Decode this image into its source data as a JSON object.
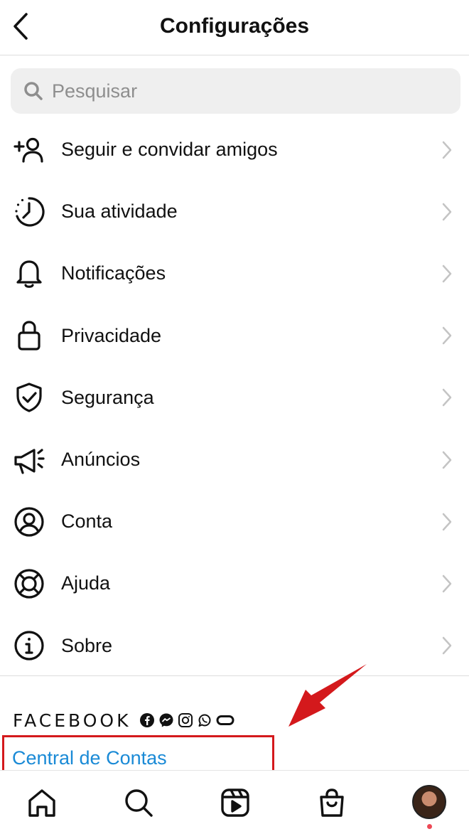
{
  "header": {
    "title": "Configurações"
  },
  "search": {
    "placeholder": "Pesquisar"
  },
  "menu": [
    {
      "label": "Seguir e convidar amigos",
      "icon": "add-person-icon"
    },
    {
      "label": "Sua atividade",
      "icon": "activity-clock-icon"
    },
    {
      "label": "Notificações",
      "icon": "bell-icon"
    },
    {
      "label": "Privacidade",
      "icon": "lock-icon"
    },
    {
      "label": "Segurança",
      "icon": "shield-check-icon"
    },
    {
      "label": "Anúncios",
      "icon": "megaphone-icon"
    },
    {
      "label": "Conta",
      "icon": "account-circle-icon"
    },
    {
      "label": "Ajuda",
      "icon": "lifebuoy-icon"
    },
    {
      "label": "Sobre",
      "icon": "info-icon"
    }
  ],
  "meta_section": {
    "brand": "FACEBOOK",
    "brand_icons": [
      "facebook-icon",
      "messenger-icon",
      "instagram-icon",
      "whatsapp-icon",
      "oculus-icon"
    ],
    "accounts_center_link": "Central de Contas"
  },
  "annotation": {
    "arrow_color": "#d4191c",
    "highlight_color": "#d4191c"
  },
  "bottom_nav": [
    "home-icon",
    "search-icon",
    "reels-icon",
    "shop-icon",
    "profile-avatar"
  ],
  "colors": {
    "link": "#1a8ad6",
    "notification_dot": "#ed4956"
  }
}
